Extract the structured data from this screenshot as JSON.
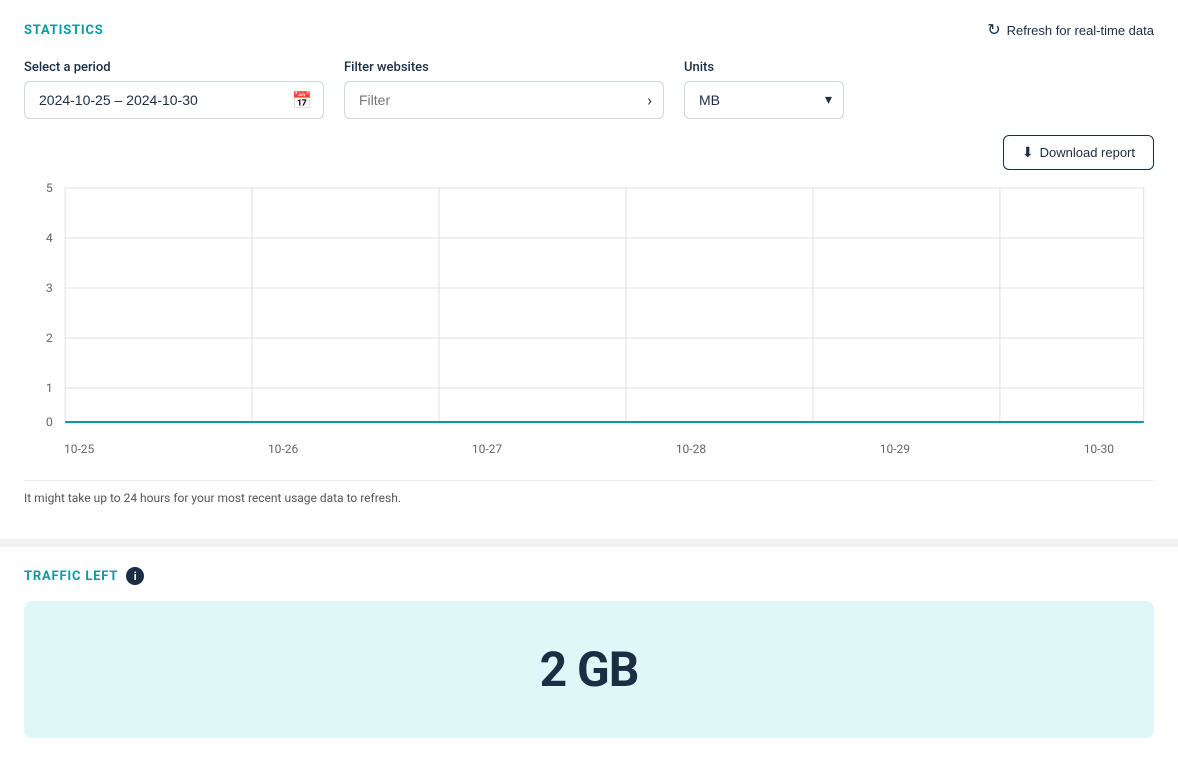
{
  "statistics": {
    "title": "STATISTICS",
    "refresh_label": "Refresh for real-time data",
    "period_label": "Select a period",
    "period_value": "2024-10-25 – 2024-10-30",
    "filter_label": "Filter websites",
    "filter_placeholder": "Filter",
    "units_label": "Units",
    "units_value": "MB",
    "download_label": "Download report",
    "chart_note": "It might take up to 24 hours for your most recent usage data to refresh.",
    "x_axis_labels": [
      "10-25",
      "10-26",
      "10-27",
      "10-28",
      "10-29",
      "10-30"
    ],
    "y_axis_labels": [
      "5",
      "4",
      "3",
      "2",
      "1",
      "0"
    ]
  },
  "traffic": {
    "title": "TRAFFIC LEFT",
    "info_label": "i",
    "value": "2 GB"
  },
  "colors": {
    "teal": "#0a9ba1",
    "dark_navy": "#1a2e44",
    "light_teal_bg": "#e0f7f8"
  }
}
